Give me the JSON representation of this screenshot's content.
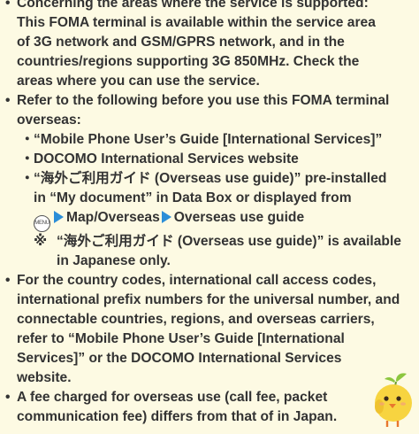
{
  "bullets": [
    {
      "lines": [
        "Concerning the areas where the service is supported:",
        "This FOMA terminal is available within the service area",
        "of 3G network and GSM/GPRS network, and in the",
        "countries/regions supporting 3G 850MHz. Check the",
        "areas where you can use the service."
      ]
    },
    {
      "lines": [
        "Refer to the following before you use this FOMA terminal",
        "overseas:"
      ],
      "subitems": [
        {
          "lines": [
            "“Mobile Phone User’s Guide [International Services]”"
          ]
        },
        {
          "lines": [
            "DOCOMO International Services website"
          ]
        },
        {
          "lines": [
            "“海外ご利用ガイド (Overseas use guide)” pre-installed",
            "in “My document” in Data Box or displayed from"
          ],
          "menu_key": "MENU",
          "path": [
            "Map/Overseas",
            "Overseas use guide"
          ],
          "note_mark": "※",
          "note_lines": [
            "“海外ご利用ガイド (Overseas use guide)” is available",
            "in Japanese only."
          ]
        }
      ]
    },
    {
      "lines": [
        "For the country codes, international call access codes,",
        "international prefix numbers for the universal number, and",
        "connectable countries, regions, and overseas carriers,",
        "refer to “Mobile Phone User’s Guide [International",
        "Services]” or the DOCOMO International Services",
        "website."
      ]
    },
    {
      "lines": [
        "A fee charged for overseas use (call fee, packet",
        "communication fee) differs from that of in Japan."
      ]
    }
  ],
  "bullet_char": "•",
  "sub_char": "・",
  "colors": {
    "background": "#fdfae3",
    "text": "#333333",
    "arrow": "#2b8ed8",
    "chick_body": "#f7d440",
    "chick_leaf": "#8cc63f",
    "chick_beak": "#e8772e"
  }
}
